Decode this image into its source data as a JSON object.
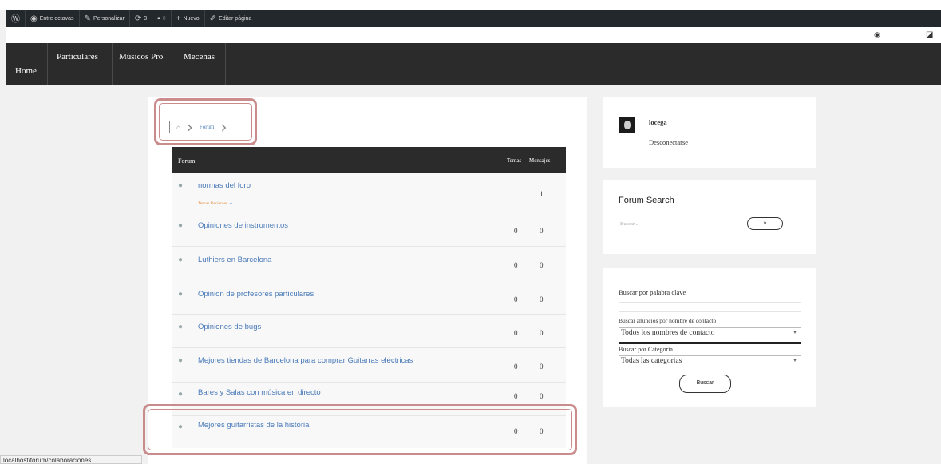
{
  "admin_bar": {
    "site_name": "Entre octavas",
    "customize": "Personalizar",
    "updates_count": "3",
    "comments_count": "0",
    "new_label": "Nuevo",
    "edit_page": "Editar página"
  },
  "nav": {
    "home": "Home",
    "items": [
      "Particulares",
      "Músicos Pro",
      "Mecenas"
    ]
  },
  "breadcrumb": {
    "forum_link": "Forum"
  },
  "forum_table": {
    "headers": {
      "forum": "Forum",
      "topics": "Temas",
      "posts": "Mensajes"
    },
    "rows": [
      {
        "title": "normas del foro",
        "sub": "Temas Recientes",
        "topics": "1",
        "posts": "1"
      },
      {
        "title": "Opiniones de instrumentos",
        "topics": "0",
        "posts": "0"
      },
      {
        "title": "Luthiers en Barcelona",
        "topics": "0",
        "posts": "0"
      },
      {
        "title": "Opinion de profesores particulares",
        "topics": "0",
        "posts": "0"
      },
      {
        "title": "Opiniones de bugs",
        "topics": "0",
        "posts": "0"
      },
      {
        "title": "Mejores tiendas de Barcelona para comprar Guitarras eléctricas",
        "topics": "0",
        "posts": "0"
      },
      {
        "title": "Bares y Salas con música en directo",
        "topics": "0",
        "posts": "0"
      },
      {
        "title": "Mejores guitarristas de la historia",
        "topics": "0",
        "posts": "0"
      }
    ]
  },
  "user_box": {
    "username": "locega",
    "logout": "Desconectarse"
  },
  "forum_search": {
    "title": "Forum Search",
    "placeholder": "Buscar...",
    "button": "»"
  },
  "ad_search": {
    "keyword_label": "Buscar por palabra clave",
    "contact_label": "Buscar anuncios por nombre de contacto",
    "contact_selected": "Todos los nombres de contacto",
    "category_label": "Buscar por Categoria",
    "category_selected": "Todas las categorias",
    "button": "Buscar"
  },
  "status_url": "localhost/forum/colaboraciones",
  "colors": {
    "nav_bg": "#2b2b2b",
    "link": "#4a7ab8",
    "highlight": "#c98b8b"
  }
}
